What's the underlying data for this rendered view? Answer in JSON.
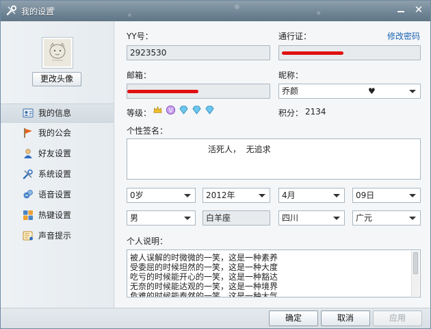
{
  "window": {
    "title": "我的设置"
  },
  "left": {
    "change_avatar_label": "更改头像",
    "nav": [
      {
        "label": "我的信息",
        "icon": "user-card-icon",
        "selected": true
      },
      {
        "label": "我的公会",
        "icon": "flag-icon",
        "selected": false
      },
      {
        "label": "好友设置",
        "icon": "person-icon",
        "selected": false
      },
      {
        "label": "系统设置",
        "icon": "tools-icon",
        "selected": false
      },
      {
        "label": "语音设置",
        "icon": "voice-icon",
        "selected": false
      },
      {
        "label": "热键设置",
        "icon": "hotkey-icon",
        "selected": false
      },
      {
        "label": "声音提示",
        "icon": "sound-icon",
        "selected": false
      }
    ]
  },
  "form": {
    "yy_label": "YY号：",
    "yy_value": "2923530",
    "pass_label": "通行证：",
    "change_pw_link": "修改密码",
    "email_label": "邮箱：",
    "nickname_label": "昵称：",
    "nickname_value": "乔颜",
    "nickname_suffix": "♥",
    "level_label": "等级：",
    "points_label": "积分：",
    "points_value": "2134",
    "signature_label": "个性签名：",
    "signature_value": "活死人，  无追求",
    "age": "0岁",
    "year": "2012年",
    "month": "4月",
    "day": "09日",
    "gender": "男",
    "zodiac": "白羊座",
    "province": "四川",
    "city": "广元",
    "desc_label": "个人说明：",
    "desc_lines": [
      "被人误解的时微微的一笑，这是一种素养",
      "受委屈的时候坦然的一笑，这是一种大度",
      "吃亏的时候能开心的一笑，这是一种豁达",
      "无奈的时候能达观的一笑，这是一种境界",
      "危难的时候能泰然的一笑，这是一种大气"
    ]
  },
  "buttons": {
    "ok": "确定",
    "cancel": "取消",
    "apply": "应用"
  },
  "colors": {
    "link": "#1a62b0",
    "redaction": "#e01010"
  }
}
